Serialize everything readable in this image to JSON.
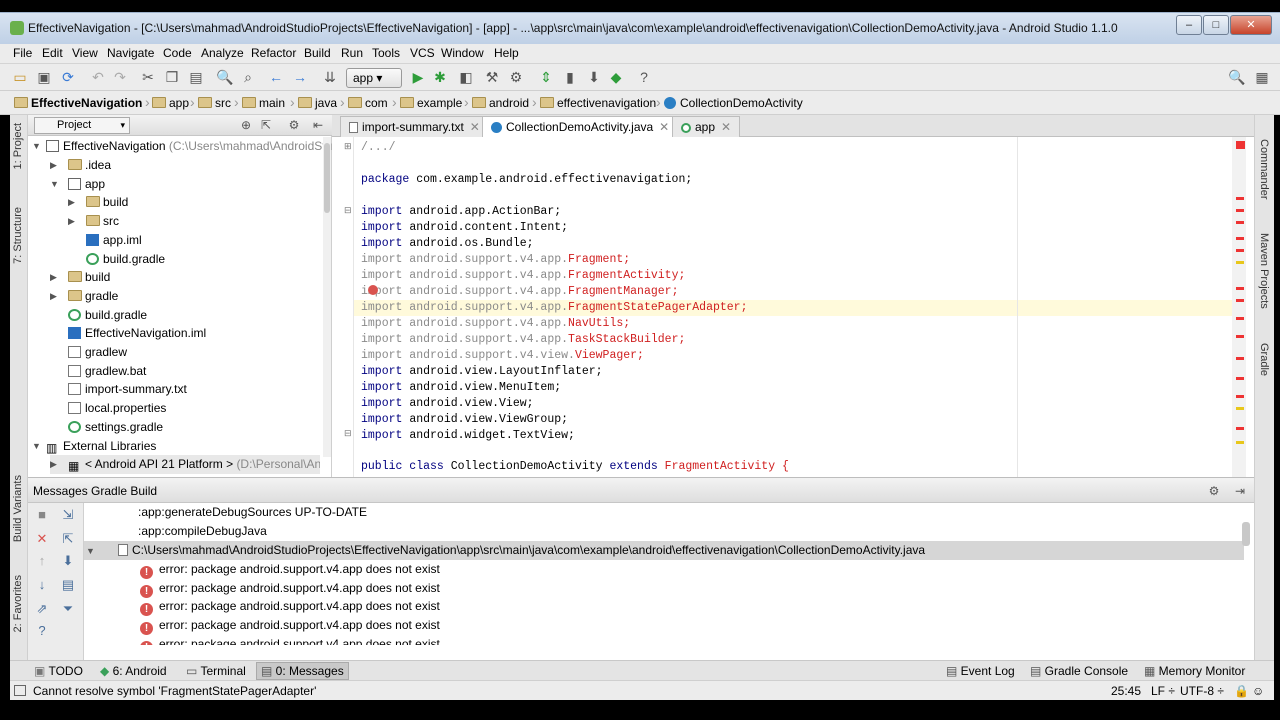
{
  "window": {
    "title": "EffectiveNavigation - [C:\\Users\\mahmad\\AndroidStudioProjects\\EffectiveNavigation] - [app] - ...\\app\\src\\main\\java\\com\\example\\android\\effectivenavigation\\CollectionDemoActivity.java - Android Studio 1.1.0",
    "minimize": "–",
    "maximize": "□",
    "close": "✕"
  },
  "menu": [
    "File",
    "Edit",
    "View",
    "Navigate",
    "Code",
    "Analyze",
    "Refactor",
    "Build",
    "Run",
    "Tools",
    "VCS",
    "Window",
    "Help"
  ],
  "toolbar": {
    "run_config": "app"
  },
  "breadcrumb": [
    "EffectiveNavigation",
    "app",
    "src",
    "main",
    "java",
    "com",
    "example",
    "android",
    "effectivenavigation",
    "CollectionDemoActivity"
  ],
  "left_tabs": {
    "project": "1: Project",
    "structure": "7: Structure",
    "build_variants": "Build Variants",
    "favorites": "2: Favorites"
  },
  "right_tabs": {
    "commander": "Commander",
    "maven": "Maven Projects",
    "gradle": "Gradle"
  },
  "project_panel": {
    "selector": "Project",
    "tree": [
      {
        "label": "EffectiveNavigation",
        "extra": "(C:\\Users\\mahmad\\AndroidStu"
      },
      {
        "label": ".idea"
      },
      {
        "label": "app"
      },
      {
        "label": "build"
      },
      {
        "label": "src"
      },
      {
        "label": "app.iml"
      },
      {
        "label": "build.gradle"
      },
      {
        "label": "build"
      },
      {
        "label": "gradle"
      },
      {
        "label": "build.gradle"
      },
      {
        "label": "EffectiveNavigation.iml"
      },
      {
        "label": "gradlew"
      },
      {
        "label": "gradlew.bat"
      },
      {
        "label": "import-summary.txt"
      },
      {
        "label": "local.properties"
      },
      {
        "label": "settings.gradle"
      },
      {
        "label": "External Libraries"
      },
      {
        "label": "< Android API 21 Platform >",
        "extra": "(D:\\Personal\\Andr"
      }
    ]
  },
  "editor": {
    "tabs": [
      {
        "label": "import-summary.txt"
      },
      {
        "label": "CollectionDemoActivity.java"
      },
      {
        "label": "app"
      }
    ],
    "lines": [
      {
        "a": "/.../"
      },
      {
        "a": "package ",
        "b": "com.example.android.effectivenavigation;"
      },
      {
        "a": "import ",
        "b": "android.app.ActionBar;"
      },
      {
        "a": "import ",
        "b": "android.content.Intent;"
      },
      {
        "a": "import ",
        "b": "android.os.Bundle;"
      },
      {
        "a": "import android.support.v4.app.",
        "b": "Fragment;"
      },
      {
        "a": "import android.support.v4.app.",
        "b": "FragmentActivity;"
      },
      {
        "a": "import android.support.v4.app.",
        "b": "FragmentManager;"
      },
      {
        "a": "import android.support.v4.app.",
        "b": "FragmentStatePagerAdapter;"
      },
      {
        "a": "import android.support.v4.app.",
        "b": "NavUtils;"
      },
      {
        "a": "import android.support.v4.app.",
        "b": "TaskStackBuilder;"
      },
      {
        "a": "import android.support.v4.view.",
        "b": "ViewPager;"
      },
      {
        "a": "import ",
        "b": "android.view.LayoutInflater;"
      },
      {
        "a": "import ",
        "b": "android.view.MenuItem;"
      },
      {
        "a": "import ",
        "b": "android.view.View;"
      },
      {
        "a": "import ",
        "b": "android.view.ViewGroup;"
      },
      {
        "a": "import ",
        "b": "android.widget.TextView;"
      },
      {
        "a": "public class ",
        "b": "CollectionDemoActivity ",
        "c": "extends ",
        "d": "FragmentActivity {"
      }
    ]
  },
  "messages": {
    "header": "Messages Gradle Build",
    "lines": [
      ":app:generateDebugSources UP-TO-DATE",
      ":app:compileDebugJava",
      "C:\\Users\\mahmad\\AndroidStudioProjects\\EffectiveNavigation\\app\\src\\main\\java\\com\\example\\android\\effectivenavigation\\CollectionDemoActivity.java",
      "error: package android.support.v4.app does not exist",
      "error: package android.support.v4.app does not exist",
      "error: package android.support.v4.app does not exist",
      "error: package android.support.v4.app does not exist",
      "error: package android.support.v4.app does not exist"
    ]
  },
  "tool_windows": {
    "todo": "TODO",
    "android": "6: Android",
    "terminal": "Terminal",
    "messages": "0: Messages",
    "event_log": "Event Log",
    "gradle_console": "Gradle Console",
    "memory_monitor": "Memory Monitor"
  },
  "status": {
    "text": "Cannot resolve symbol 'FragmentStatePagerAdapter'",
    "position": "25:45",
    "line_sep": "LF ÷",
    "encoding": "UTF-8 ÷"
  }
}
